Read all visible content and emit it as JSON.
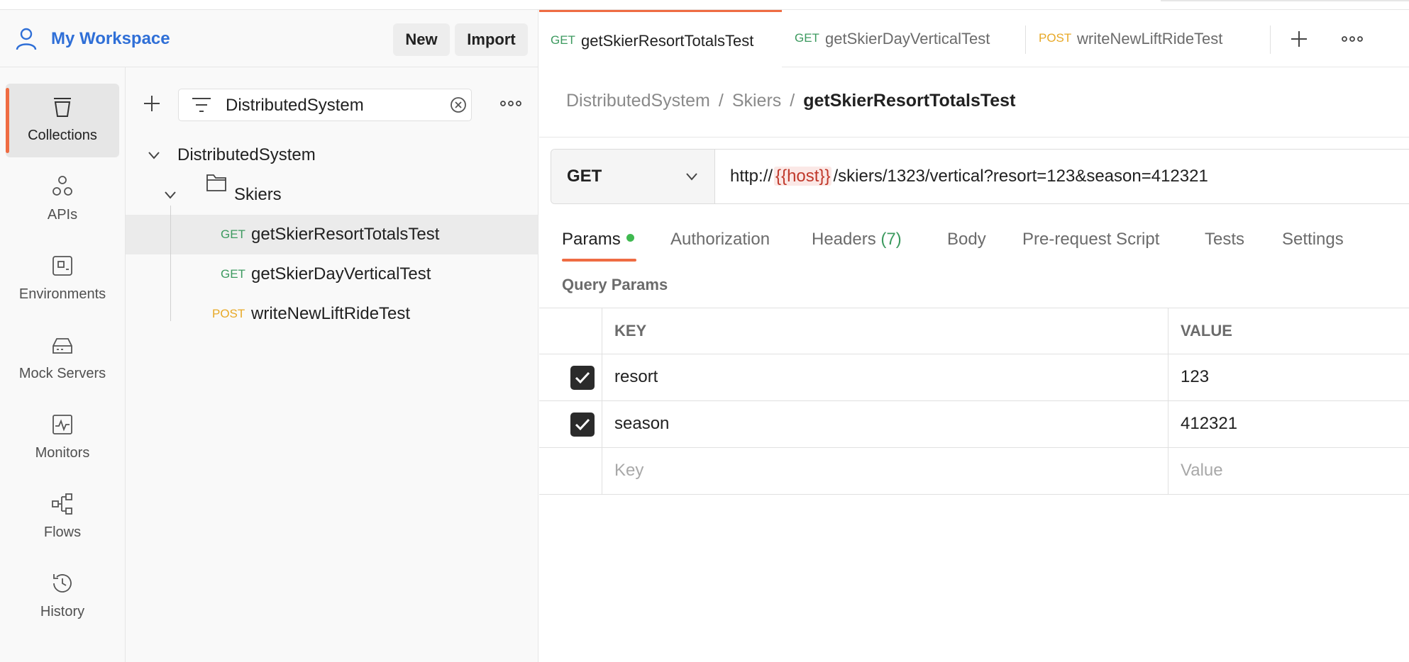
{
  "workspace": {
    "title": "My Workspace",
    "new_label": "New",
    "import_label": "Import"
  },
  "nav": {
    "items": [
      {
        "label": "Collections",
        "icon": "collections-icon"
      },
      {
        "label": "APIs",
        "icon": "apis-icon"
      },
      {
        "label": "Environments",
        "icon": "environments-icon"
      },
      {
        "label": "Mock Servers",
        "icon": "mock-servers-icon"
      },
      {
        "label": "Monitors",
        "icon": "monitors-icon"
      },
      {
        "label": "Flows",
        "icon": "flows-icon"
      },
      {
        "label": "History",
        "icon": "history-icon"
      }
    ]
  },
  "sidebar": {
    "filter_value": "DistributedSystem",
    "collection": "DistributedSystem",
    "folder": "Skiers",
    "requests": [
      {
        "method": "GET",
        "name": "getSkierResortTotalsTest"
      },
      {
        "method": "GET",
        "name": "getSkierDayVerticalTest"
      },
      {
        "method": "POST",
        "name": "writeNewLiftRideTest"
      }
    ]
  },
  "tabs": [
    {
      "method": "GET",
      "name": "getSkierResortTotalsTest"
    },
    {
      "method": "GET",
      "name": "getSkierDayVerticalTest"
    },
    {
      "method": "POST",
      "name": "writeNewLiftRideTest"
    }
  ],
  "breadcrumb": {
    "collection": "DistributedSystem",
    "folder": "Skiers",
    "current": "getSkierResortTotalsTest",
    "separator": "/"
  },
  "request": {
    "method": "GET",
    "url_prefix": "http://",
    "url_var": "{{host}}",
    "url_suffix": "/skiers/1323/vertical?resort=123&season=412321"
  },
  "request_tabs": {
    "params": "Params",
    "authorization": "Authorization",
    "headers": "Headers",
    "headers_count": "(7)",
    "body": "Body",
    "prerequest": "Pre-request Script",
    "tests": "Tests",
    "settings": "Settings"
  },
  "query_params": {
    "title": "Query Params",
    "key_header": "KEY",
    "value_header": "VALUE",
    "rows": [
      {
        "key": "resort",
        "value": "123",
        "checked": true
      },
      {
        "key": "season",
        "value": "412321",
        "checked": true
      }
    ],
    "key_placeholder": "Key",
    "value_placeholder": "Value"
  },
  "colors": {
    "accent": "#ef6c43",
    "get": "#3c9a5f",
    "post": "#e8a927",
    "link": "#2f6fd7",
    "variable": "#c0392b"
  }
}
